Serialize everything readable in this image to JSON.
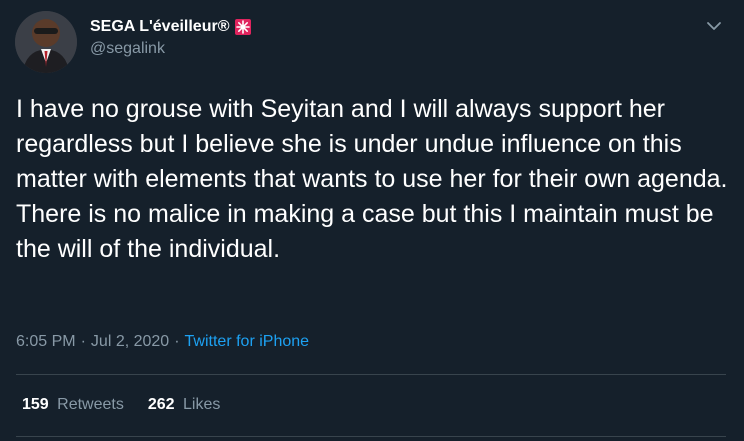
{
  "user": {
    "display_name": "SEGA L'éveilleur®",
    "badge_icon": "siren-icon",
    "handle": "@segalink"
  },
  "tweet": {
    "text": "I have no grouse with Seyitan and I will always support her regardless but I believe she is under undue influence on this matter with elements that wants to use her for their own agenda. There is no malice in making a case but this I maintain must be the will of the individual."
  },
  "meta": {
    "time": "6:05 PM",
    "separator": "·",
    "date": "Jul 2, 2020",
    "source": "Twitter for iPhone"
  },
  "stats": {
    "retweets_count": "159",
    "retweets_label": "Retweets",
    "likes_count": "262",
    "likes_label": "Likes"
  },
  "colors": {
    "background": "#15202b",
    "secondary_text": "#8899a6",
    "link": "#1da1f2",
    "divider": "#38444d",
    "badge": "#e0245e"
  }
}
